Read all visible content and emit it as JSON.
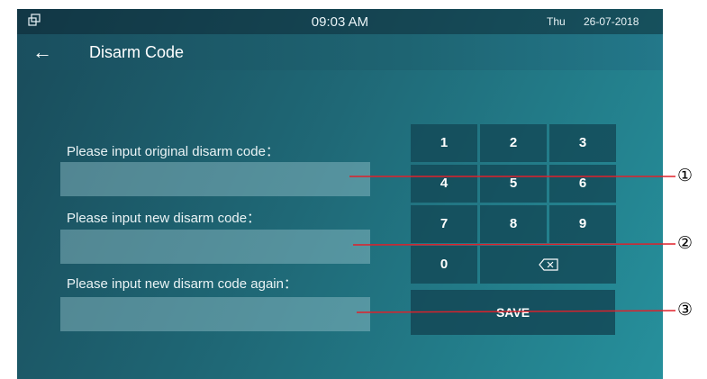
{
  "status_bar": {
    "window_icon": "window-restore-icon",
    "time": "09:03 AM",
    "day": "Thu",
    "date": "26-07-2018"
  },
  "header": {
    "back_icon": "arrow-left-icon",
    "back_glyph": "←",
    "title": "Disarm Code"
  },
  "form": {
    "original_label": "Please input original disarm code：",
    "original_value": "",
    "new_label": "Please input new disarm code：",
    "new_value": "",
    "confirm_label": "Please input new disarm code again：",
    "confirm_value": ""
  },
  "keypad": {
    "keys": [
      "1",
      "2",
      "3",
      "4",
      "5",
      "6",
      "7",
      "8",
      "9",
      "0"
    ],
    "backspace_icon": "backspace-icon",
    "save_label": "SAVE"
  },
  "callouts": [
    "①",
    "②",
    "③"
  ],
  "colors": {
    "background_dark": "#194b5a",
    "background_light": "#26909c",
    "key_background": "#124654",
    "callout_line": "#e0202a"
  }
}
